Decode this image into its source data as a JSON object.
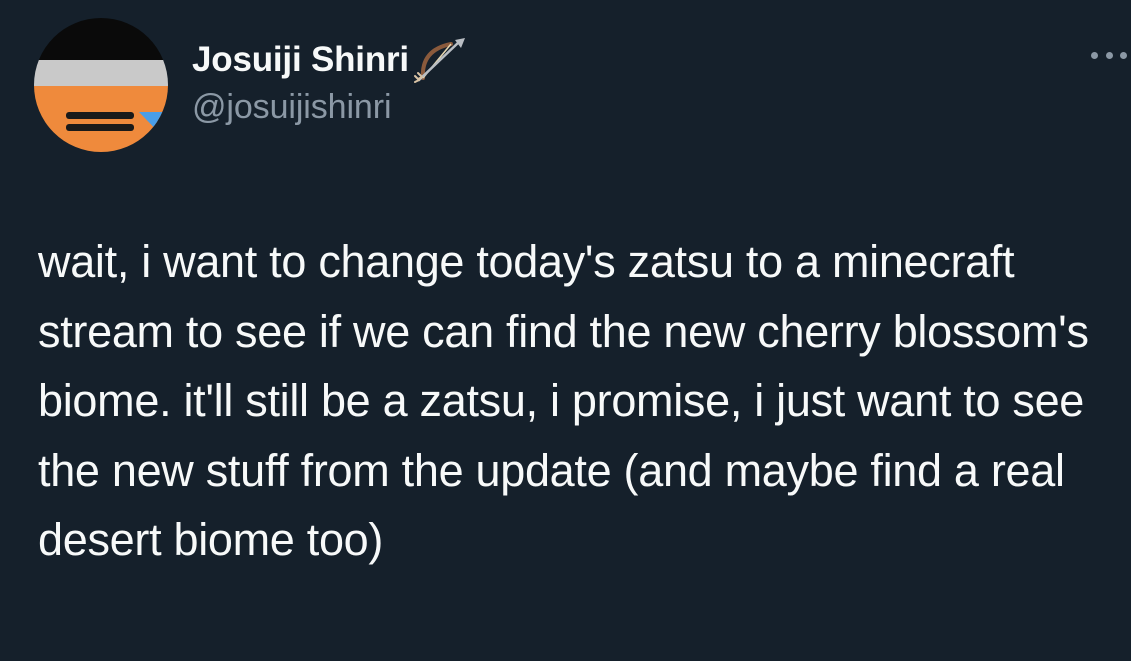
{
  "tweet": {
    "author": {
      "display_name": "Josuiji Shinri",
      "name_emoji_icon": "bow-and-arrow-icon",
      "handle": "@josuijishinri",
      "avatar_colors": {
        "black": "#0a0a0a",
        "gray": "#c9c9c9",
        "orange": "#ef8a3c",
        "blue": "#4a9ee8"
      }
    },
    "more_menu_icon": "more-horizontal-icon",
    "text": "wait, i want to change today's zatsu to a minecraft stream to see if we can find the new cherry blossom's biome. it'll still be a zatsu, i promise, i just want to see the new stuff from the update (and maybe find a real desert biome too)"
  },
  "theme": {
    "background": "#15202b",
    "primary_text": "#f7f9f9",
    "secondary_text": "#8b98a5"
  }
}
